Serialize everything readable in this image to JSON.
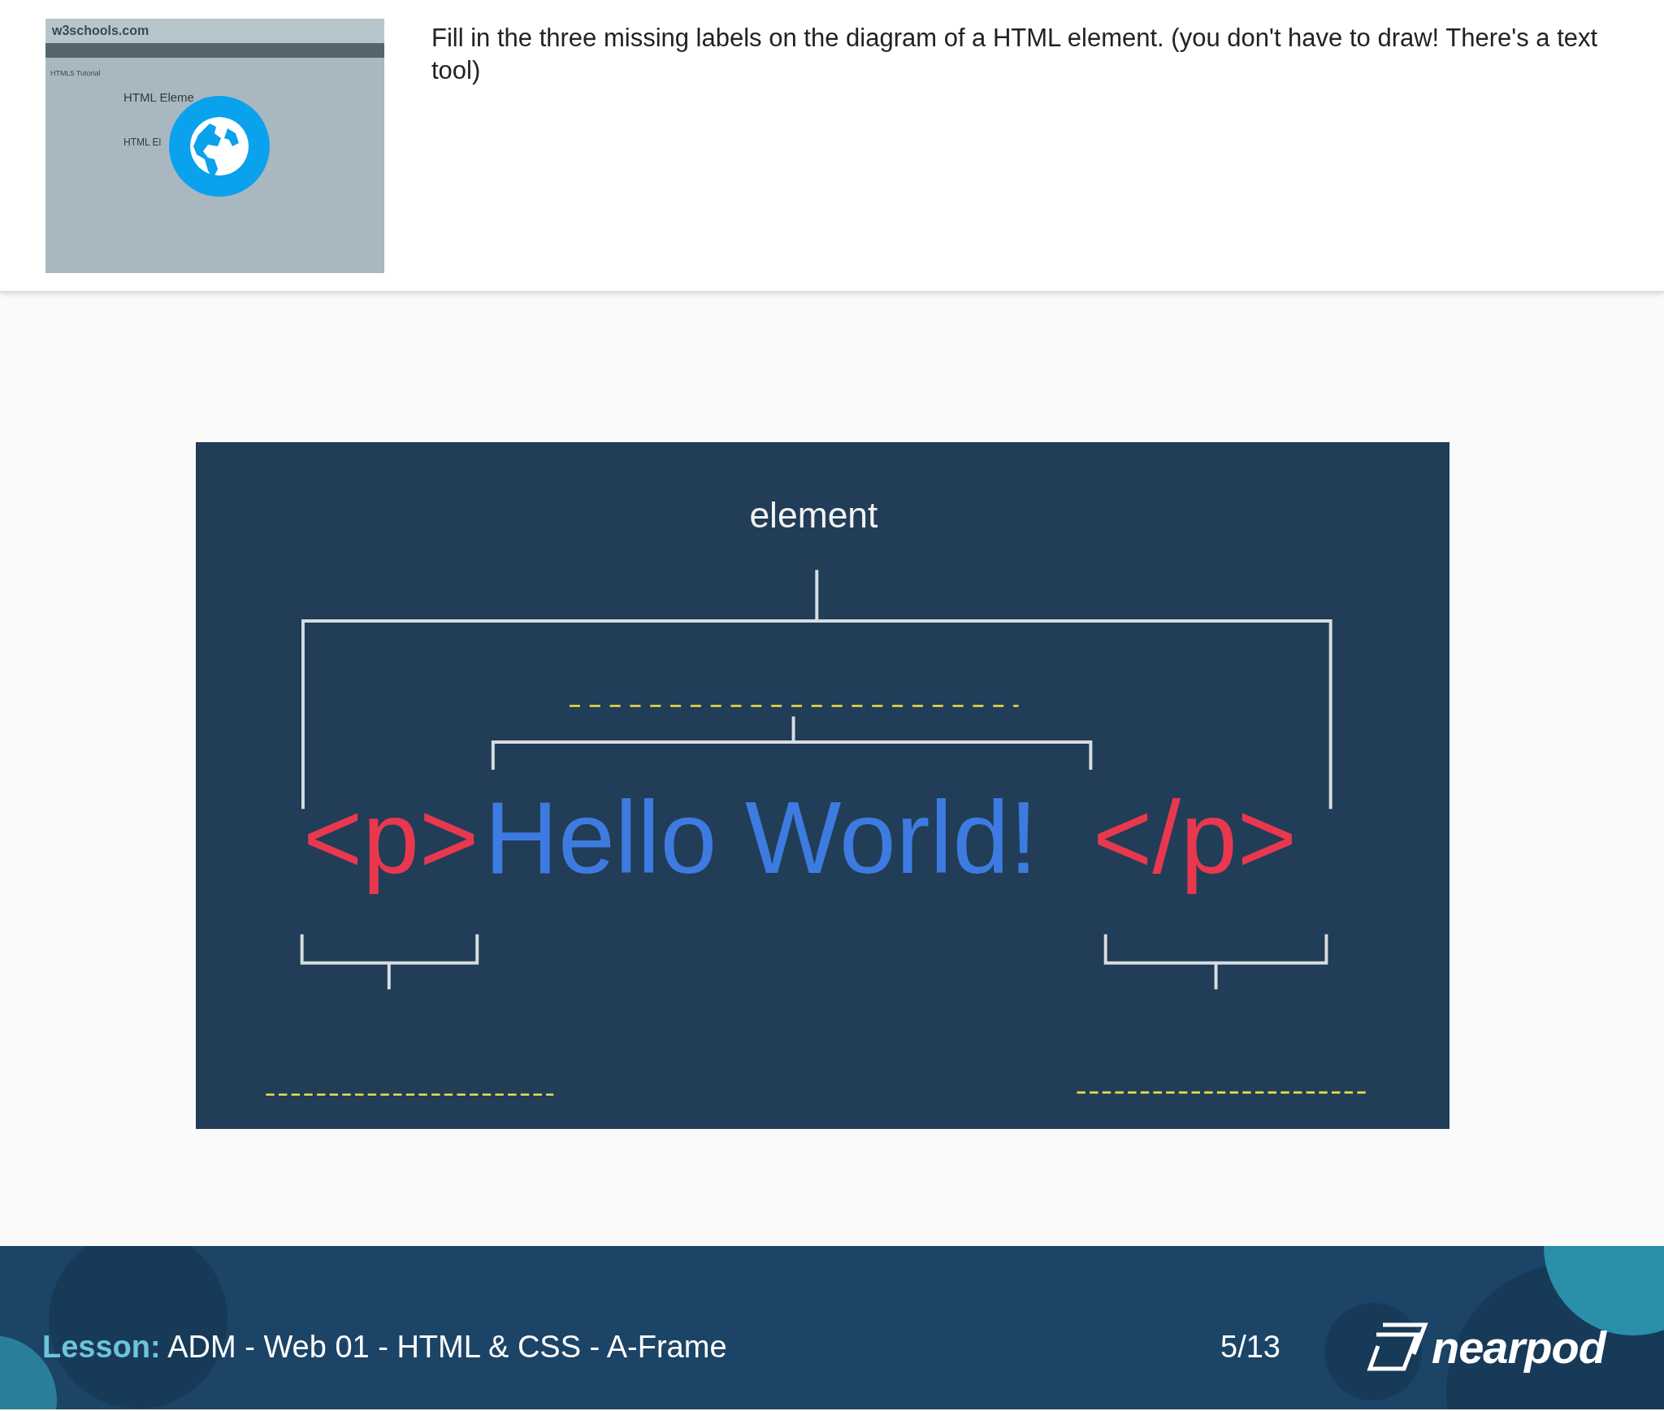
{
  "thumbnail": {
    "site": "w3schools.com",
    "sidebar_title": "HTML5 Tutorial",
    "heading": "HTML Eleme",
    "subheading": "HTML El"
  },
  "question": "Fill in the three missing labels on the diagram of a HTML element. (you don't have to draw! There's a text tool)",
  "diagram": {
    "label": "element",
    "code": [
      {
        "kind": "tag",
        "text": "<p>"
      },
      {
        "kind": "content",
        "text": "Hello World!"
      },
      {
        "kind": "tag",
        "text": "</p>"
      }
    ]
  },
  "footer": {
    "lesson_label": "Lesson:",
    "lesson_title": "ADM - Web 01 - HTML & CSS - A-Frame",
    "page": "5/13",
    "logo": "nearpod"
  }
}
